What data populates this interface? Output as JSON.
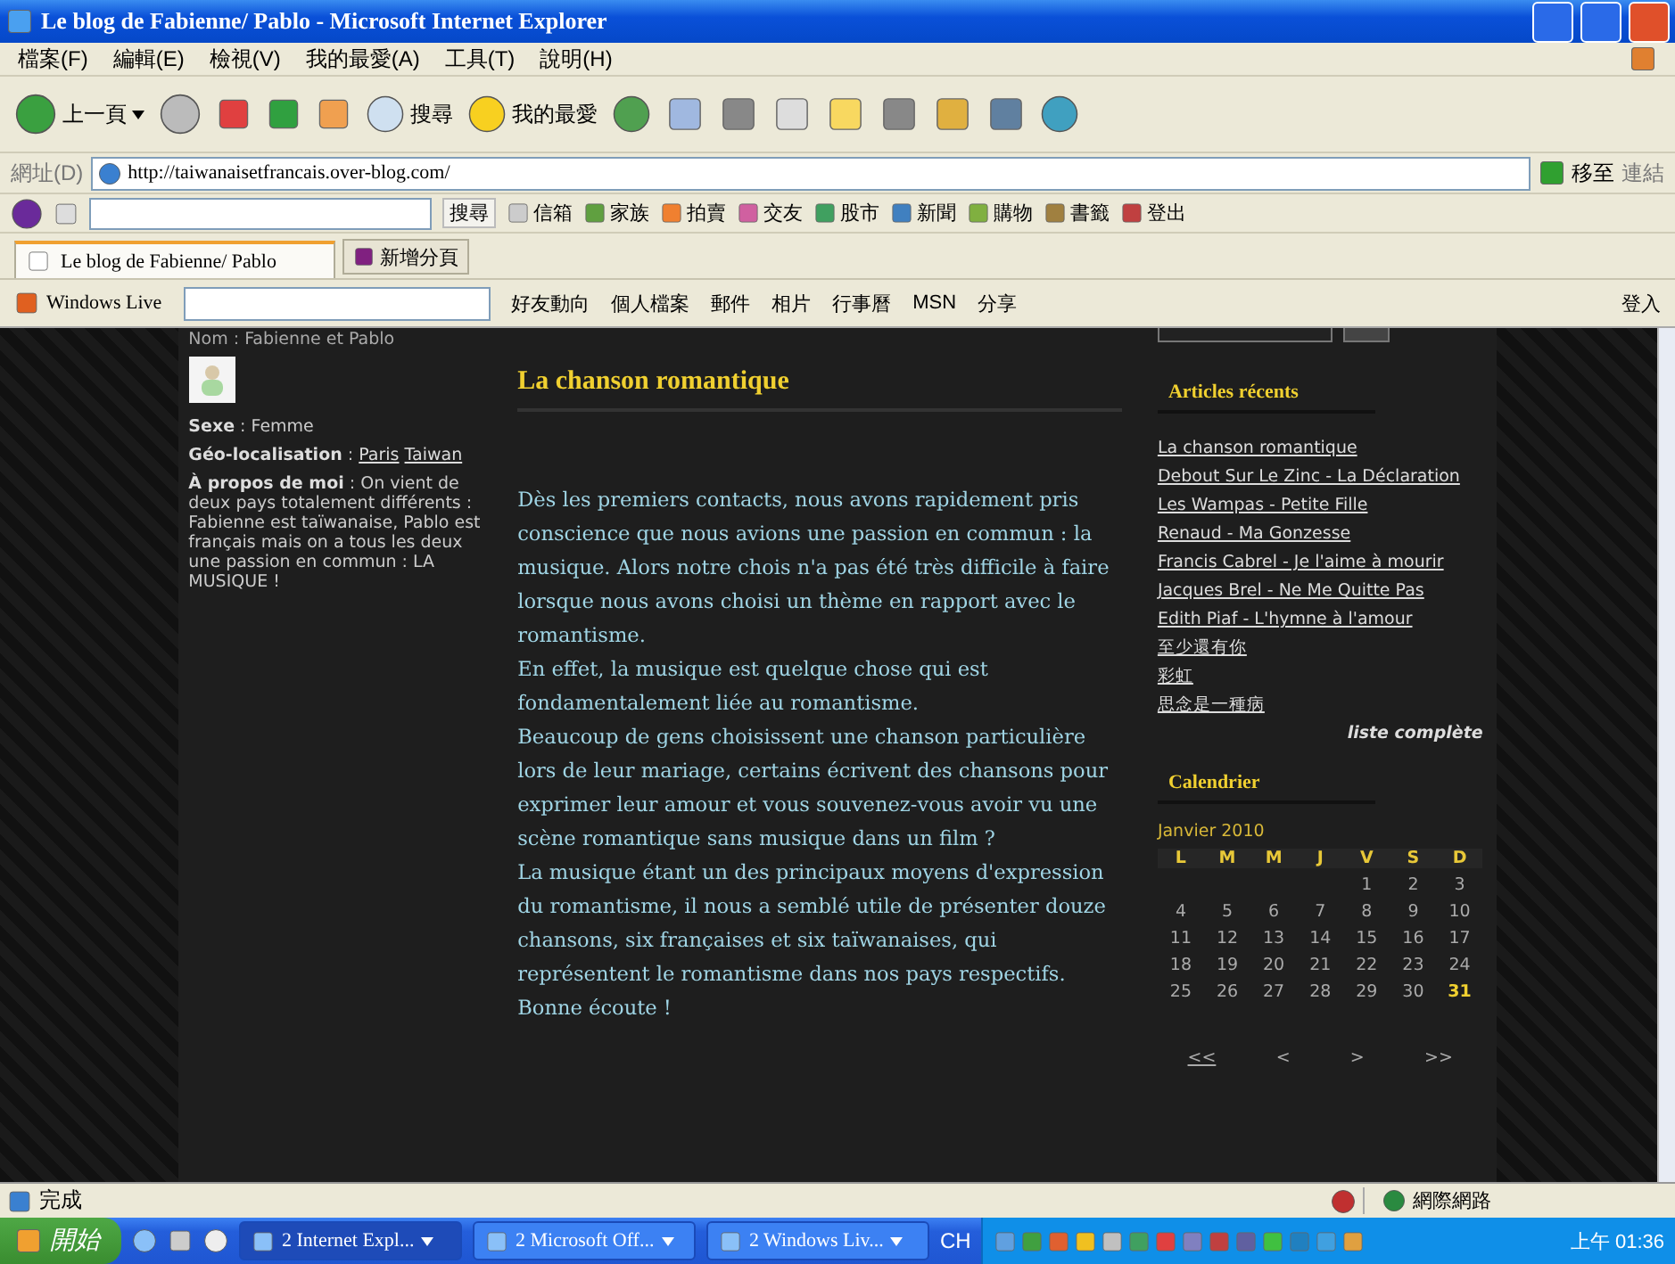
{
  "window": {
    "title": "Le blog de Fabienne/ Pablo - Microsoft Internet Explorer"
  },
  "menu": [
    "檔案(F)",
    "編輯(E)",
    "檢視(V)",
    "我的最愛(A)",
    "工具(T)",
    "說明(H)"
  ],
  "toolbar": {
    "back": "上一頁",
    "search": "搜尋",
    "favorites": "我的最愛"
  },
  "address": {
    "label": "網址(D)",
    "url": "http://taiwanaisetfrancais.over-blog.com/",
    "go": "移至",
    "links": "連結"
  },
  "yahoo_bar": {
    "search": "搜尋",
    "items": [
      "信箱",
      "家族",
      "拍賣",
      "交友",
      "股市",
      "新聞",
      "購物",
      "書籤",
      "登出"
    ]
  },
  "tabs": [
    {
      "label": "Le blog de Fabienne/ Pablo",
      "selected": true
    }
  ],
  "new_tab": "新增分頁",
  "live_bar": {
    "brand": "Windows Live",
    "links": [
      "好友動向",
      "個人檔案",
      "郵件",
      "相片",
      "行事曆",
      "MSN",
      "分享"
    ],
    "sign_in": "登入"
  },
  "profile": {
    "name": "Nom : Fabienne et Pablo",
    "sex": "**Sexe** : Femme",
    "geo_label": "**Géo-localisation** :",
    "places": [
      "Paris",
      "Taiwan"
    ],
    "about": "**À propos de moi** : On vient de deux pays totalement différents : Fabienne est taïwanaise, Pablo est français mais on a tous les deux une passion en commun : LA MUSIQUE !"
  },
  "article": {
    "title": "La chanson romantique",
    "paragraphs": [
      "Dès les premiers contacts, nous avons rapidement pris conscience que nous avions une passion en commun : la musique. Alors notre chois n'a pas été très difficile à faire lorsque nous avons choisi un thème en rapport avec le romantisme.",
      "En effet, la musique est quelque chose qui est fondamentalement liée au romantisme.",
      "Beaucoup de gens choisissent une chanson particulière lors de leur mariage, certains écrivent des chansons pour exprimer leur amour et vous souvenez-vous avoir vu une scène romantique sans musique dans un film ?",
      "La musique étant un des principaux moyens d'expression du romantisme, il nous a semblé utile de présenter douze chansons, six françaises et six taïwanaises, qui représentent le romantisme dans nos pays respectifs.",
      "Bonne écoute !"
    ]
  },
  "recent": {
    "title": "Articles récents",
    "items": [
      "La chanson romantique",
      "Debout Sur Le Zinc - La Déclaration",
      "Les Wampas - Petite Fille",
      "Renaud - Ma Gonzesse",
      "Francis Cabrel - Je l'aime à mourir",
      "Jacques Brel - Ne Me Quitte Pas",
      "Edith Piaf - L'hymne à l'amour",
      "至少還有你",
      "彩虹",
      "思念是一種病"
    ],
    "more": "liste complète"
  },
  "calendar": {
    "title": "Calendrier",
    "month": "Janvier 2010",
    "weekdays": [
      "L",
      "M",
      "M",
      "J",
      "V",
      "S",
      "D"
    ],
    "weeks": [
      [
        {
          "day": "1",
          "highlighted": false
        },
        {
          "day": "2",
          "highlighted": false
        },
        {
          "day": "3",
          "highlighted": false
        }
      ],
      [
        {
          "day": "4",
          "highlighted": false
        },
        {
          "day": "5",
          "highlighted": false
        },
        {
          "day": "6",
          "highlighted": false
        },
        {
          "day": "7",
          "highlighted": false
        },
        {
          "day": "8",
          "highlighted": false
        },
        {
          "day": "9",
          "highlighted": false
        },
        {
          "day": "10",
          "highlighted": false
        }
      ],
      [
        {
          "day": "11",
          "highlighted": false
        },
        {
          "day": "12",
          "highlighted": false
        },
        {
          "day": "13",
          "highlighted": false
        },
        {
          "day": "14",
          "highlighted": false
        },
        {
          "day": "15",
          "highlighted": false
        },
        {
          "day": "16",
          "highlighted": false
        },
        {
          "day": "17",
          "highlighted": false
        }
      ],
      [
        {
          "day": "18",
          "highlighted": false
        },
        {
          "day": "19",
          "highlighted": false
        },
        {
          "day": "20",
          "highlighted": false
        },
        {
          "day": "21",
          "highlighted": false
        },
        {
          "day": "22",
          "highlighted": false
        },
        {
          "day": "23",
          "highlighted": false
        },
        {
          "day": "24",
          "highlighted": false
        }
      ],
      [
        {
          "day": "25",
          "highlighted": false
        },
        {
          "day": "26",
          "highlighted": false
        },
        {
          "day": "27",
          "highlighted": false
        },
        {
          "day": "28",
          "highlighted": false
        },
        {
          "day": "29",
          "highlighted": false
        },
        {
          "day": "30",
          "highlighted": false
        },
        {
          "day": "31",
          "highlighted": true
        }
      ]
    ],
    "nav": [
      "<<",
      "<",
      ">",
      ">>"
    ]
  },
  "status_bar": {
    "text": "完成",
    "zone": "網際網路"
  },
  "taskbar": {
    "start": "開始",
    "tasks": [
      {
        "label": "2 Internet Expl...",
        "selected": true
      },
      {
        "label": "2 Microsoft Off...",
        "selected": false
      },
      {
        "label": "2 Windows Liv...",
        "selected": false
      }
    ],
    "language": "CH",
    "clock": "上午 01:36"
  }
}
